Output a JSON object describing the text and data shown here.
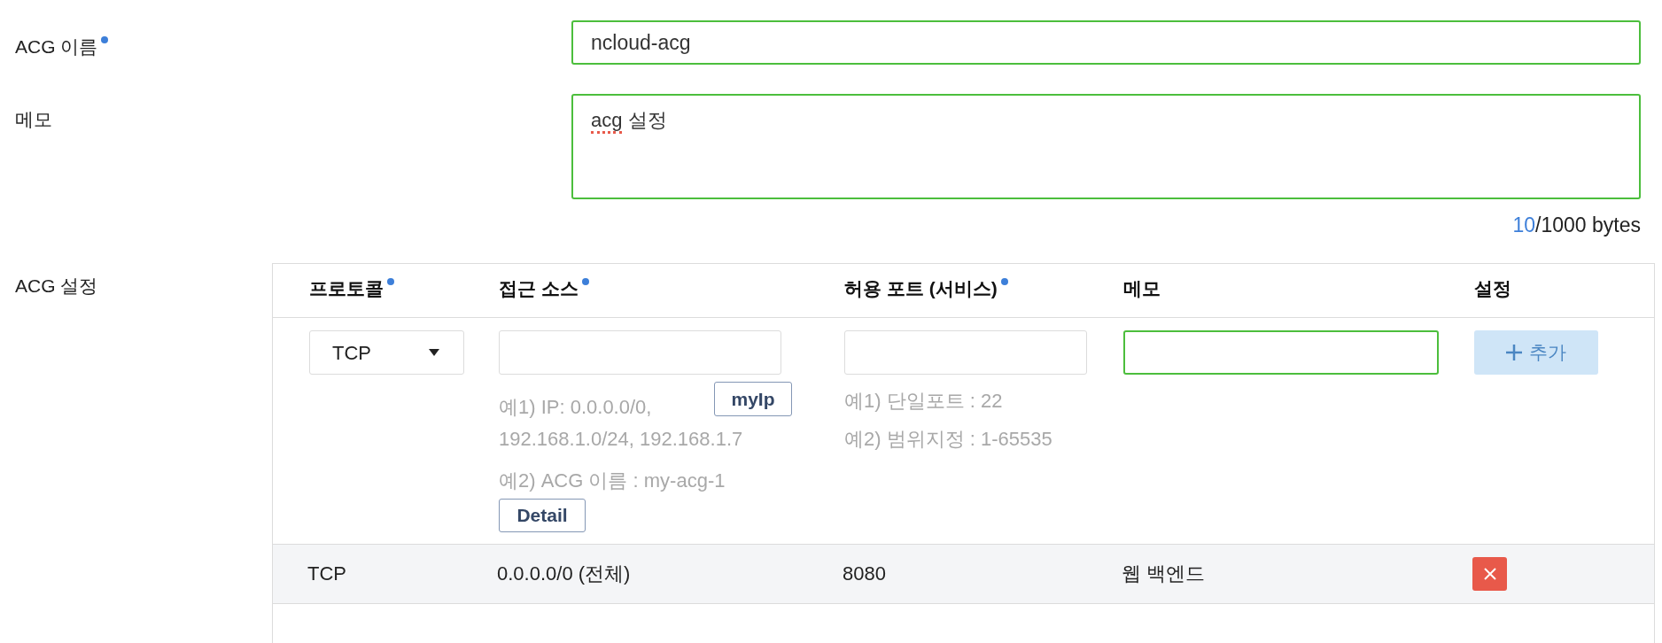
{
  "name_field": {
    "label": "ACG 이름",
    "required": true,
    "value": "ncloud-acg",
    "valid": true
  },
  "memo_field": {
    "label": "메모",
    "required": false,
    "value_parts": [
      {
        "text": "acg",
        "spell_error": true
      },
      {
        "text": " 설정",
        "spell_error": false
      }
    ],
    "valid": true,
    "byte_count": "10",
    "byte_limit": "/1000 bytes"
  },
  "acg_settings": {
    "label": "ACG 설정",
    "columns": [
      {
        "label": "프로토콜",
        "required": true
      },
      {
        "label": "접근 소스",
        "required": true
      },
      {
        "label": "허용 포트 (서비스)",
        "required": true
      },
      {
        "label": "메모",
        "required": false
      },
      {
        "label": "설정",
        "required": false
      }
    ],
    "new_rule": {
      "protocol": {
        "value": "TCP"
      },
      "source": {
        "valid": false,
        "my_ip_button": "myIp",
        "hints": [
          {
            "lines": [
              "예1) IP: 0.0.0.0/0,",
              "192.168.1.0/24, 192.168.1.7"
            ]
          },
          {
            "lines": [
              "예2) ACG 이름 : my-acg-1"
            ]
          }
        ],
        "detail_button": "Detail"
      },
      "port": {
        "valid": false,
        "hints": [
          "예1) 단일포트 : 22",
          "예2) 범위지정 : 1-65535"
        ]
      },
      "memo": {
        "valid": true
      },
      "add_button": {
        "label": "추가",
        "disabled": true
      }
    },
    "rules": [
      {
        "protocol": "TCP",
        "source": "0.0.0.0/0 (전체)",
        "port": "8080",
        "memo": "웹 백엔드"
      }
    ]
  }
}
